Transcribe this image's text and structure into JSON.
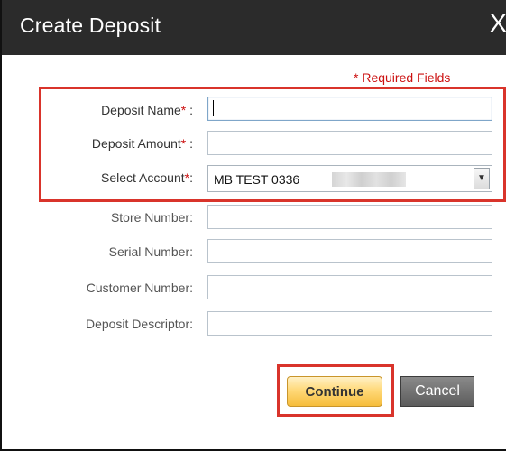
{
  "dialog": {
    "title": "Create Deposit",
    "close_label": "X",
    "required_note": "* Required Fields"
  },
  "form": {
    "deposit_name": {
      "label": "Deposit Name",
      "required_mark": "*",
      "suffix": " :",
      "value": ""
    },
    "deposit_amount": {
      "label": "Deposit Amount",
      "required_mark": "*",
      "suffix": " :",
      "value": ""
    },
    "select_account": {
      "label": "Select Account",
      "required_mark": "*",
      "suffix": ":",
      "value": "MB TEST 0336"
    },
    "store_number": {
      "label": "Store Number:",
      "value": ""
    },
    "serial_number": {
      "label": "Serial Number:",
      "value": ""
    },
    "customer_number": {
      "label": "Customer Number:",
      "value": ""
    },
    "deposit_descriptor": {
      "label": "Deposit Descriptor:",
      "value": ""
    }
  },
  "buttons": {
    "continue_label": "Continue",
    "cancel_label": "Cancel"
  },
  "colors": {
    "titlebar": "#2b2b2b",
    "required": "#cc1111",
    "highlight": "#d9342b",
    "continue_button": "#f6bd3b",
    "cancel_button": "#5c5c5c"
  },
  "icons": {
    "select_arrow": "chevron-down-icon"
  }
}
